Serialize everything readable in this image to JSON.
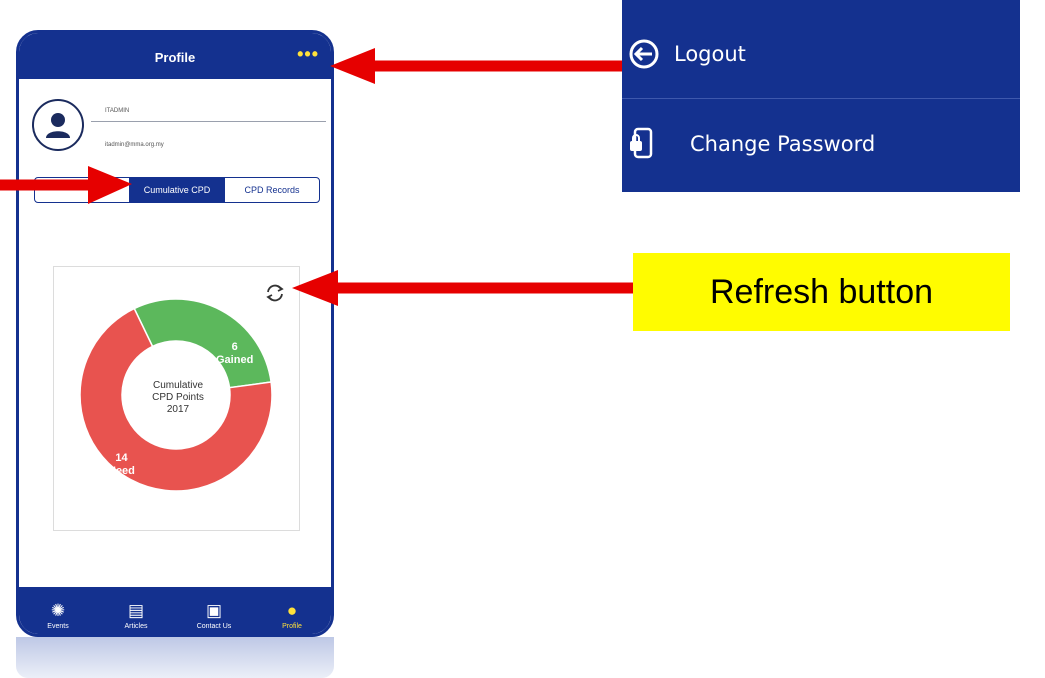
{
  "header": {
    "title": "Profile",
    "more_label": "•••"
  },
  "user": {
    "name": "ITADMIN",
    "email": "itadmin@mma.org.my"
  },
  "segments": [
    {
      "label": ""
    },
    {
      "label": "Cumulative CPD"
    },
    {
      "label": "CPD Records"
    }
  ],
  "chart_data": {
    "type": "pie",
    "title": "Cumulative CPD Points 2017",
    "center_lines": [
      "Cumulative",
      "CPD Points",
      "2017"
    ],
    "slices": [
      {
        "name": "Gained",
        "value": 6,
        "color": "#5cb85c"
      },
      {
        "name": "Need",
        "value": 14,
        "color": "#e8534f"
      }
    ]
  },
  "tabs": [
    {
      "label": "Events",
      "icon": "events-icon"
    },
    {
      "label": "Articles",
      "icon": "articles-icon"
    },
    {
      "label": "Contact Us",
      "icon": "contact-icon"
    },
    {
      "label": "Profile",
      "icon": "profile-icon"
    }
  ],
  "menu": {
    "items": [
      {
        "label": "Logout",
        "icon": "logout-icon"
      },
      {
        "label": "Change Password",
        "icon": "lock-phone-icon"
      }
    ]
  },
  "callout": {
    "text": "Refresh  button"
  },
  "colors": {
    "brand": "#14318f",
    "accent": "#ffe13a",
    "arrow": "#e60000",
    "callout": "#fffc00"
  }
}
